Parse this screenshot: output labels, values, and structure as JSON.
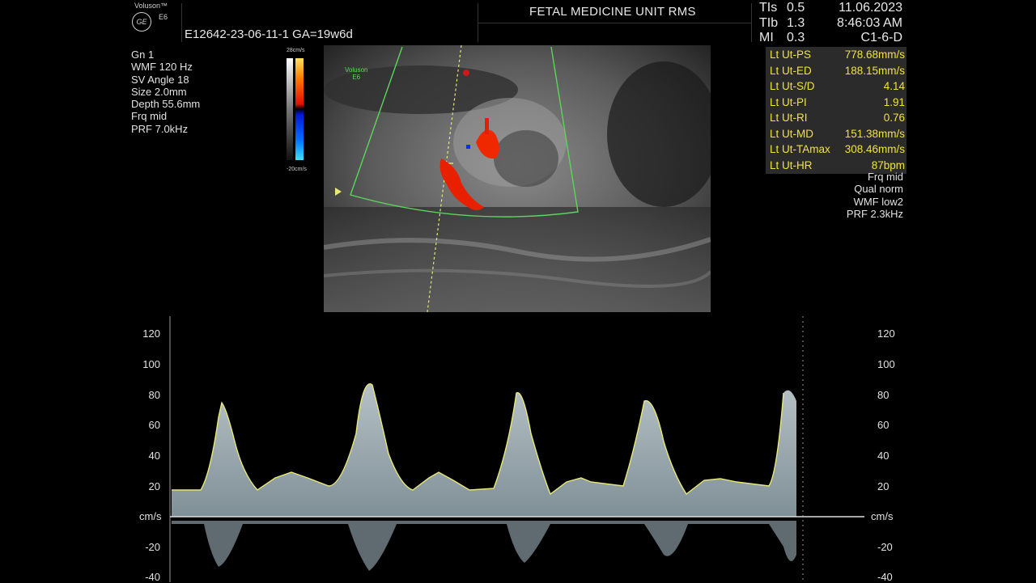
{
  "header": {
    "brand": "Voluson™",
    "logo": "GE",
    "model": "E6",
    "patient_line": "E12642-23-06-11-1  GA=19w6d",
    "unit_name": "FETAL MEDICINE UNIT RMS",
    "safety": [
      {
        "label": "TIs",
        "value": "0.5"
      },
      {
        "label": "TIb",
        "value": "1.3"
      },
      {
        "label": "MI",
        "value": "0.3"
      }
    ],
    "date": "11.06.2023",
    "time": "8:46:03 AM",
    "probe": "C1-6-D"
  },
  "left_params": [
    "Gn  1",
    "WMF 120 Hz",
    "SV Angle 18",
    "Size  2.0mm",
    "Depth 55.6mm",
    "Frq mid",
    "PRF  7.0kHz"
  ],
  "color_bar": {
    "top_label": "28cm/s",
    "bottom_label": "-20cm/s"
  },
  "image_logo": {
    "line1": "Voluson",
    "line2": "E6"
  },
  "measurements": [
    {
      "label": "Lt Ut-PS",
      "value": "778.68mm/s"
    },
    {
      "label": "Lt Ut-ED",
      "value": "188.15mm/s"
    },
    {
      "label": "Lt Ut-S/D",
      "value": "4.14"
    },
    {
      "label": "Lt Ut-PI",
      "value": "1.91"
    },
    {
      "label": "Lt Ut-RI",
      "value": "0.76"
    },
    {
      "label": "Lt Ut-MD",
      "value": "151.38mm/s"
    },
    {
      "label": "Lt Ut-TAmax",
      "value": "308.46mm/s"
    },
    {
      "label": "Lt Ut-HR",
      "value": "87bpm"
    }
  ],
  "doppler_params": [
    "Frq mid",
    "Qual norm",
    "WMF low2",
    "PRF  2.3kHz"
  ],
  "spectral": {
    "unit_label": "cm/s",
    "ticks": [
      "120",
      "100",
      "80",
      "60",
      "40",
      "20",
      "-20",
      "-40"
    ],
    "tick_values": [
      120,
      100,
      80,
      60,
      40,
      20,
      -20,
      -40
    ]
  },
  "colors": {
    "measure_text": "#f0e33a",
    "sector": "#5bd65b",
    "envelope": "#e8e878",
    "flow_red": "#e82000"
  }
}
